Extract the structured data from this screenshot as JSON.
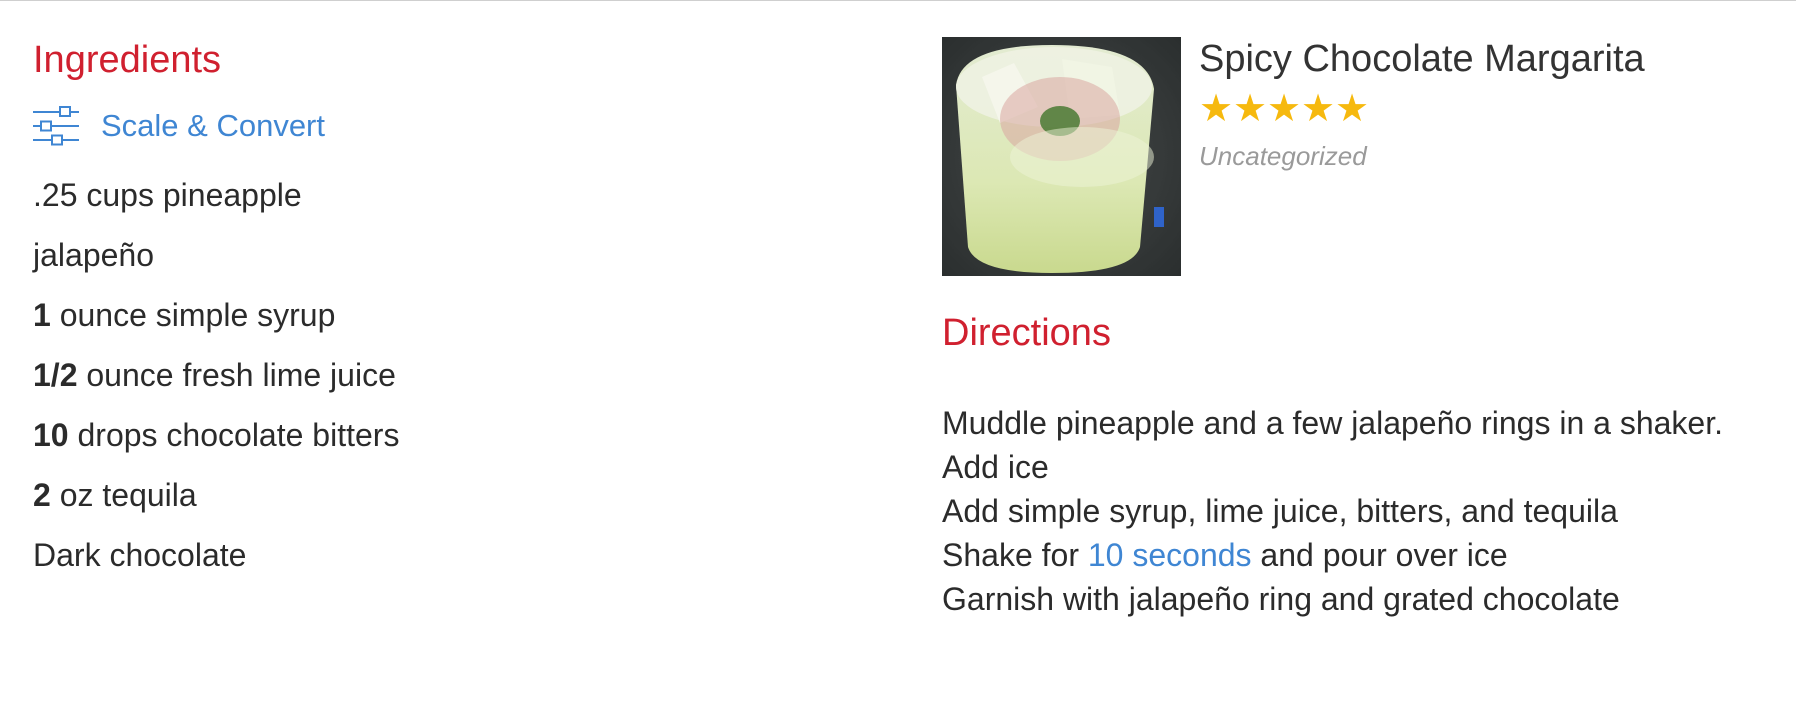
{
  "ingredients": {
    "heading": "Ingredients",
    "scale_convert_label": "Scale & Convert",
    "items": [
      {
        "qty": "",
        "text": ".25 cups pineapple"
      },
      {
        "qty": "",
        "text": "jalapeño"
      },
      {
        "qty": "1",
        "text": " ounce simple syrup"
      },
      {
        "qty": "1/2",
        "text": " ounce fresh lime juice"
      },
      {
        "qty": "10",
        "text": " drops chocolate bitters"
      },
      {
        "qty": "2",
        "text": " oz tequila"
      },
      {
        "qty": "",
        "text": "Dark chocolate"
      }
    ]
  },
  "recipe": {
    "title": "Spicy Chocolate Margarita",
    "rating": 5,
    "category": "Uncategorized",
    "photo": "cocktail-photo"
  },
  "directions": {
    "heading": "Directions",
    "line1": "Muddle pineapple and a few jalapeño rings in a shaker.",
    "line2": "Add ice",
    "line3": "Add simple syrup, lime juice, bitters, and tequila",
    "line4_before": "Shake for ",
    "line4_timer": "10 seconds",
    "line4_after": " and pour over ice",
    "line5": "Garnish with jalapeño ring and grated chocolate"
  },
  "colors": {
    "heading": "#d0202f",
    "link": "#3f86d3",
    "star": "#f6b90e",
    "muted": "#9a9a9a"
  }
}
